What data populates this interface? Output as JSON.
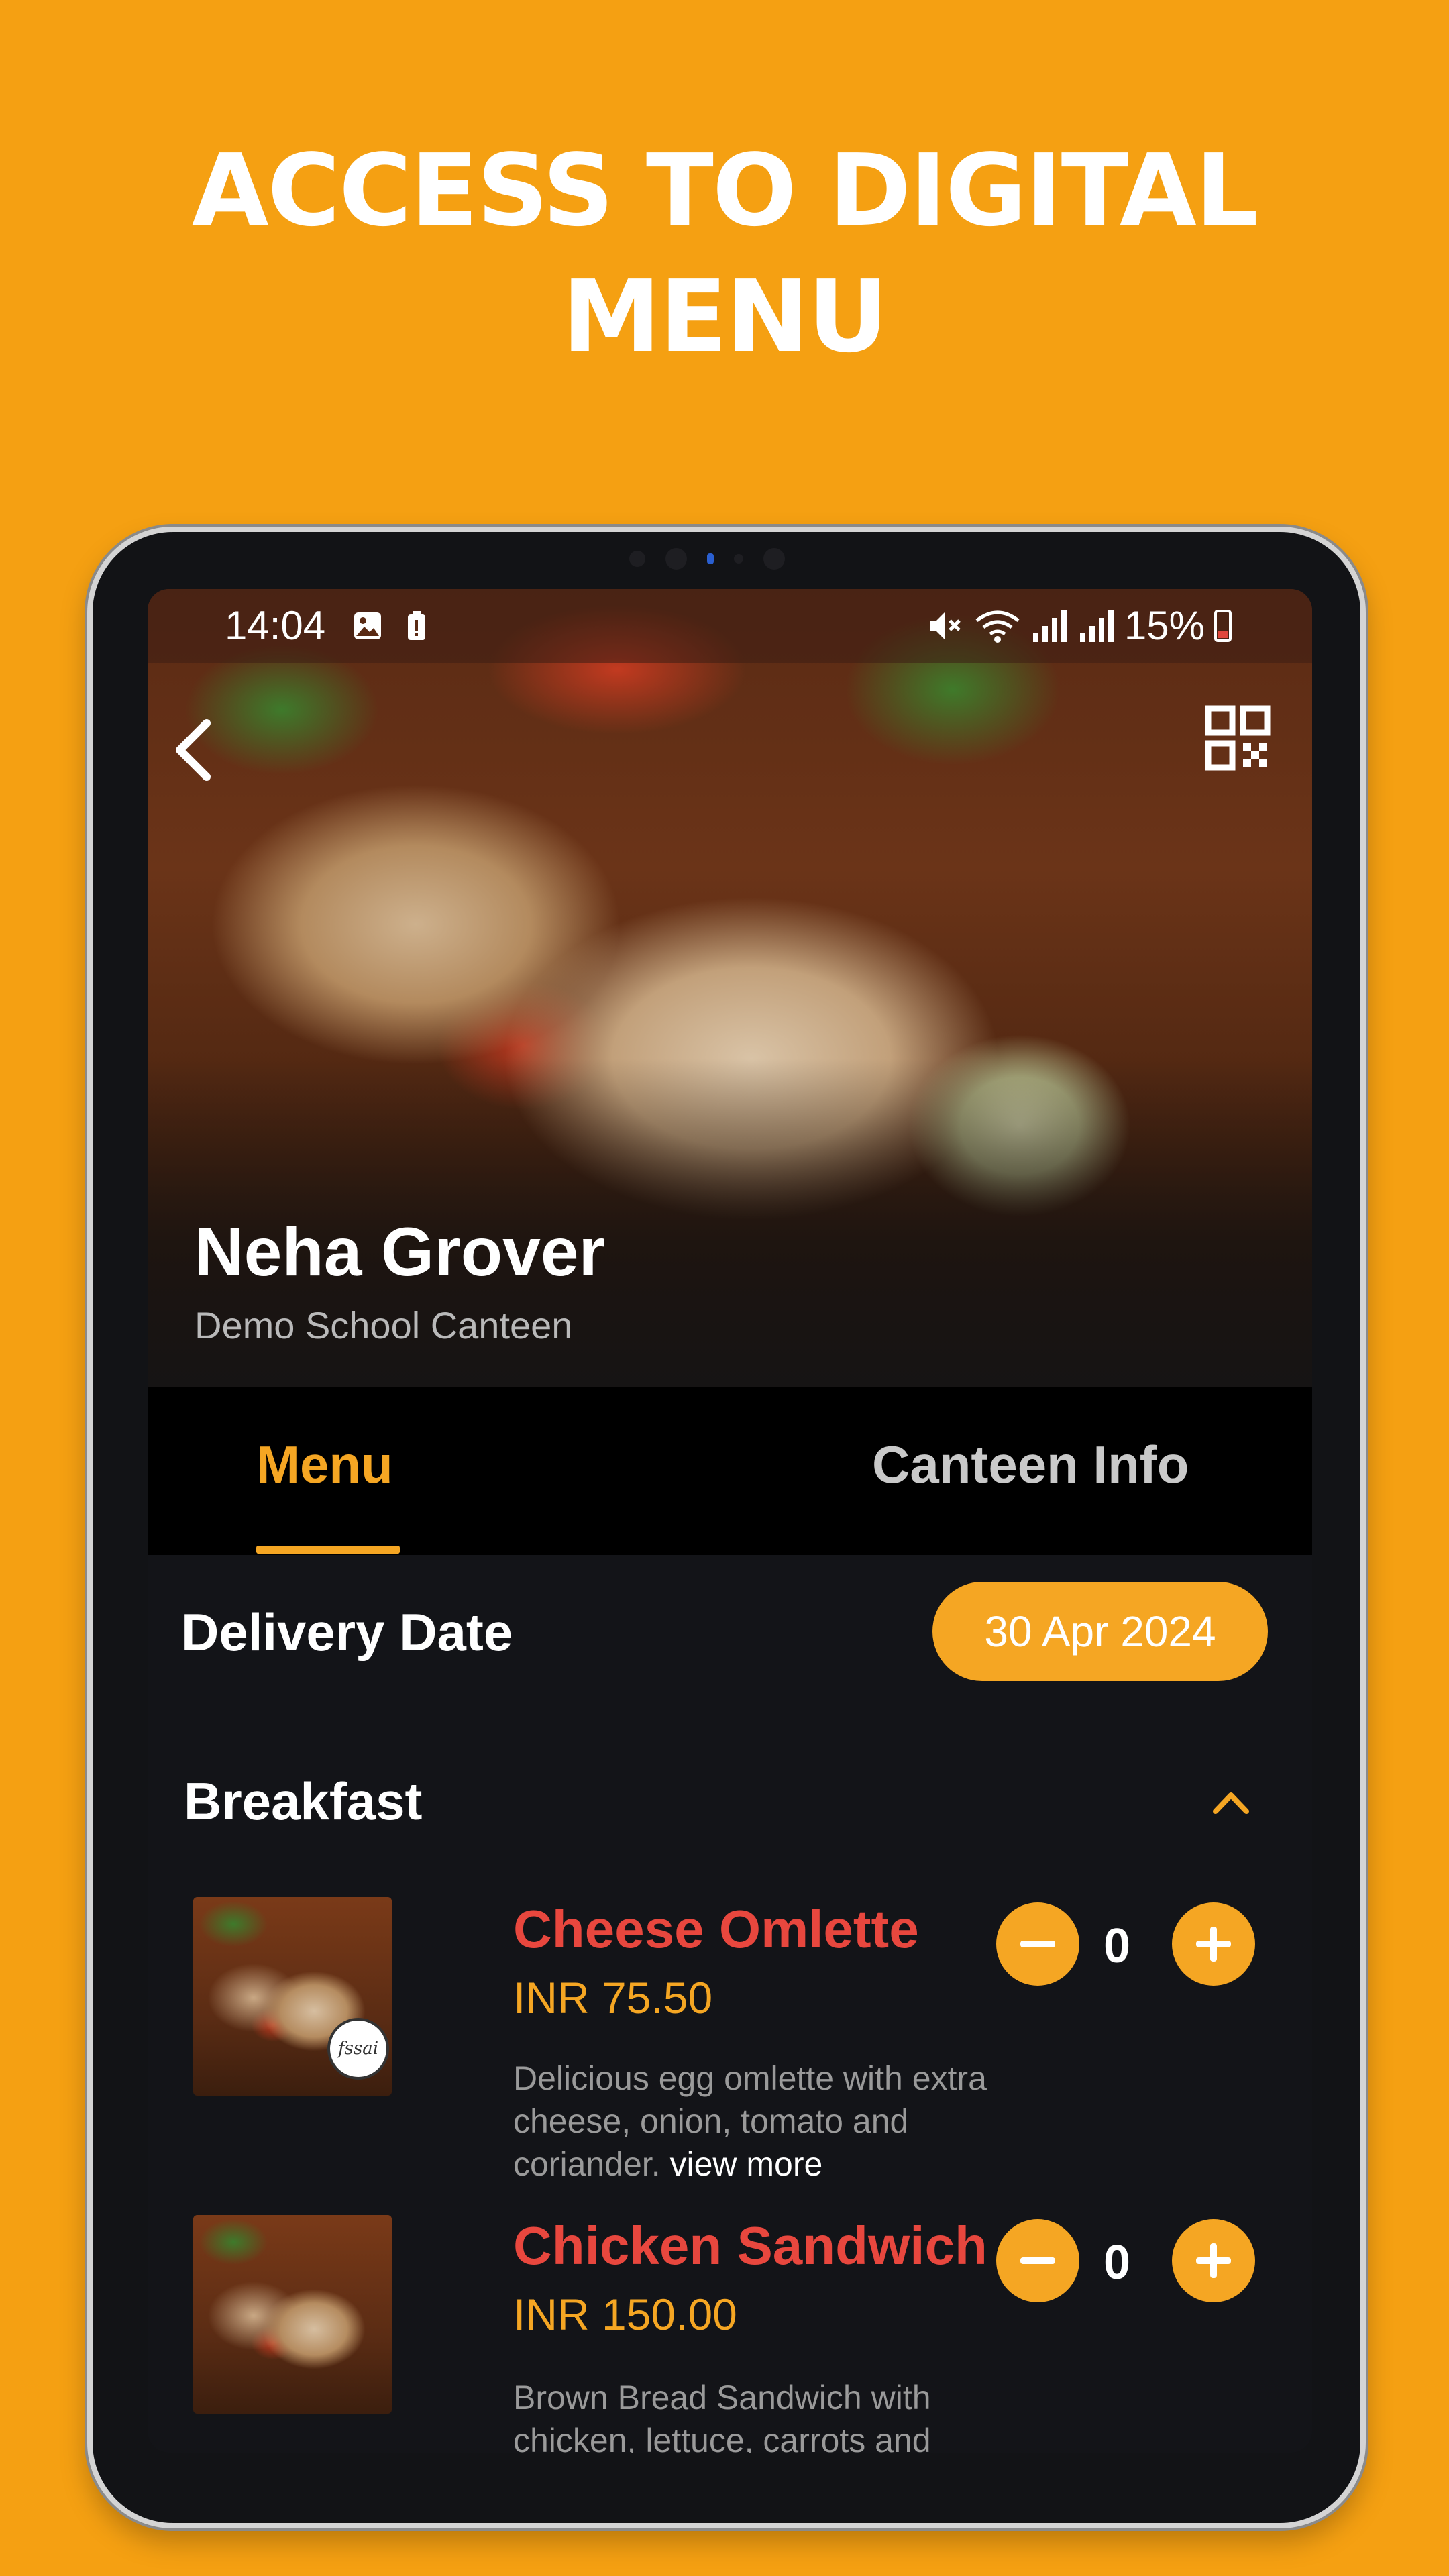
{
  "headline": {
    "line1": "ACCESS TO DIGITAL",
    "line2": "MENU"
  },
  "status_bar": {
    "time": "14:04",
    "battery_pct": "15%"
  },
  "header": {
    "owner_name": "Neha Grover",
    "canteen_name": "Demo School Canteen"
  },
  "tabs": [
    {
      "label": "Menu",
      "active": true
    },
    {
      "label": "Canteen Info",
      "active": false
    }
  ],
  "delivery": {
    "label": "Delivery Date",
    "date": "30 Apr 2024"
  },
  "section": {
    "title": "Breakfast"
  },
  "items": [
    {
      "name": "Cheese Omlette",
      "price": "INR 75.50",
      "desc_lines": [
        "Delicious egg omlette with extra",
        "cheese, onion, tomato and",
        "coriander. "
      ],
      "view_more": "view more",
      "badge": "fssai",
      "quantity": "0"
    },
    {
      "name": "Chicken Sandwich",
      "price": "INR 150.00",
      "desc_lines": [
        "Brown Bread Sandwich with",
        "chicken, lettuce, carrots and"
      ],
      "quantity": "0"
    }
  ],
  "colors": {
    "background": "#F5A012",
    "accent": "#F5A623",
    "item_name": "#E8473E",
    "screen": "#131418"
  },
  "icons": [
    "back-icon",
    "qr-code-icon",
    "gallery-icon",
    "battery-alert-icon",
    "mute-icon",
    "wifi-icon",
    "signal-icon",
    "battery-icon",
    "chevron-up-icon",
    "minus-icon",
    "plus-icon"
  ]
}
